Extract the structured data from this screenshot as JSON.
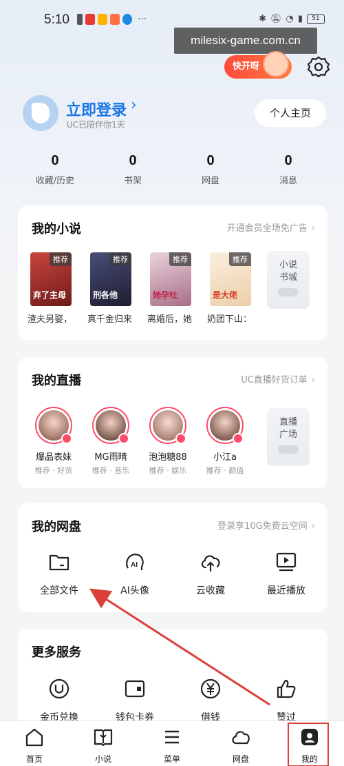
{
  "status_bar": {
    "time": "5:10",
    "dots": "···",
    "battery": "51",
    "app_icon_colors": [
      "#e53935",
      "#ffb300",
      "#ff7043",
      "#1e88e5"
    ]
  },
  "watermark": "milesix-game.com.cn",
  "promo": {
    "label": "快开呀"
  },
  "header": {
    "login_title": "立即登录",
    "login_subtitle": "UC已陪伴你1天",
    "profile_button": "个人主页"
  },
  "stats": [
    {
      "value": "0",
      "label": "收藏/历史"
    },
    {
      "value": "0",
      "label": "书架"
    },
    {
      "value": "0",
      "label": "网盘"
    },
    {
      "value": "0",
      "label": "消息"
    }
  ],
  "novels": {
    "title": "我的小说",
    "link": "开通会员全场免广告",
    "books": [
      {
        "name": "渣夫另娶，",
        "tag": "推荐",
        "cover_text": "弃了主母",
        "color": "#a0322e"
      },
      {
        "name": "真千金归来",
        "tag": "推荐",
        "cover_text": "刑各他",
        "color": "#2d2f4a"
      },
      {
        "name": "离婚后，她",
        "tag": "推荐",
        "cover_text": "她孕吐",
        "color": "#c9a9b8"
      },
      {
        "name": "奶团下山：",
        "tag": "推荐",
        "cover_text": "是大佬",
        "color": "#f2dcc2"
      }
    ],
    "side_tile": {
      "line1": "小说",
      "line2": "书城"
    }
  },
  "live": {
    "title": "我的直播",
    "link": "UC直播好货订单",
    "streamers": [
      {
        "name": "爆品表妹",
        "tag": "推荐 · 好货",
        "color": "#e6b7a8"
      },
      {
        "name": "MG雨晴",
        "tag": "推荐 · 音乐",
        "color": "#c7a59a"
      },
      {
        "name": "泡泡糖88",
        "tag": "推荐 · 娱乐",
        "color": "#d9b6b0"
      },
      {
        "name": "小江a",
        "tag": "推荐 · 颜值",
        "color": "#d2b7a9"
      }
    ],
    "side_tile": {
      "line1": "直播",
      "line2": "广场"
    }
  },
  "netdisk": {
    "title": "我的网盘",
    "link": "登录享10G免费云空间",
    "items": [
      {
        "label": "全部文件",
        "icon": "folder-icon"
      },
      {
        "label": "AI头像",
        "icon": "ai-avatar-icon"
      },
      {
        "label": "云收藏",
        "icon": "cloud-upload-icon"
      },
      {
        "label": "最近播放",
        "icon": "recent-play-icon"
      }
    ]
  },
  "services": {
    "title": "更多服务",
    "items": [
      {
        "label": "金币兑换",
        "icon": "coin-icon"
      },
      {
        "label": "钱包卡券",
        "icon": "wallet-icon"
      },
      {
        "label": "借钱",
        "icon": "yuan-icon"
      },
      {
        "label": "赞过",
        "icon": "thumbs-up-icon"
      }
    ]
  },
  "bottom_nav": [
    {
      "label": "首页",
      "icon": "home-icon"
    },
    {
      "label": "小说",
      "icon": "book-icon"
    },
    {
      "label": "菜单",
      "icon": "menu-icon"
    },
    {
      "label": "网盘",
      "icon": "cloud-icon"
    },
    {
      "label": "我的",
      "icon": "profile-icon"
    }
  ],
  "colors": {
    "accent": "#1a76e6",
    "annotation": "#d9413a",
    "live": "#ff4a6a"
  }
}
